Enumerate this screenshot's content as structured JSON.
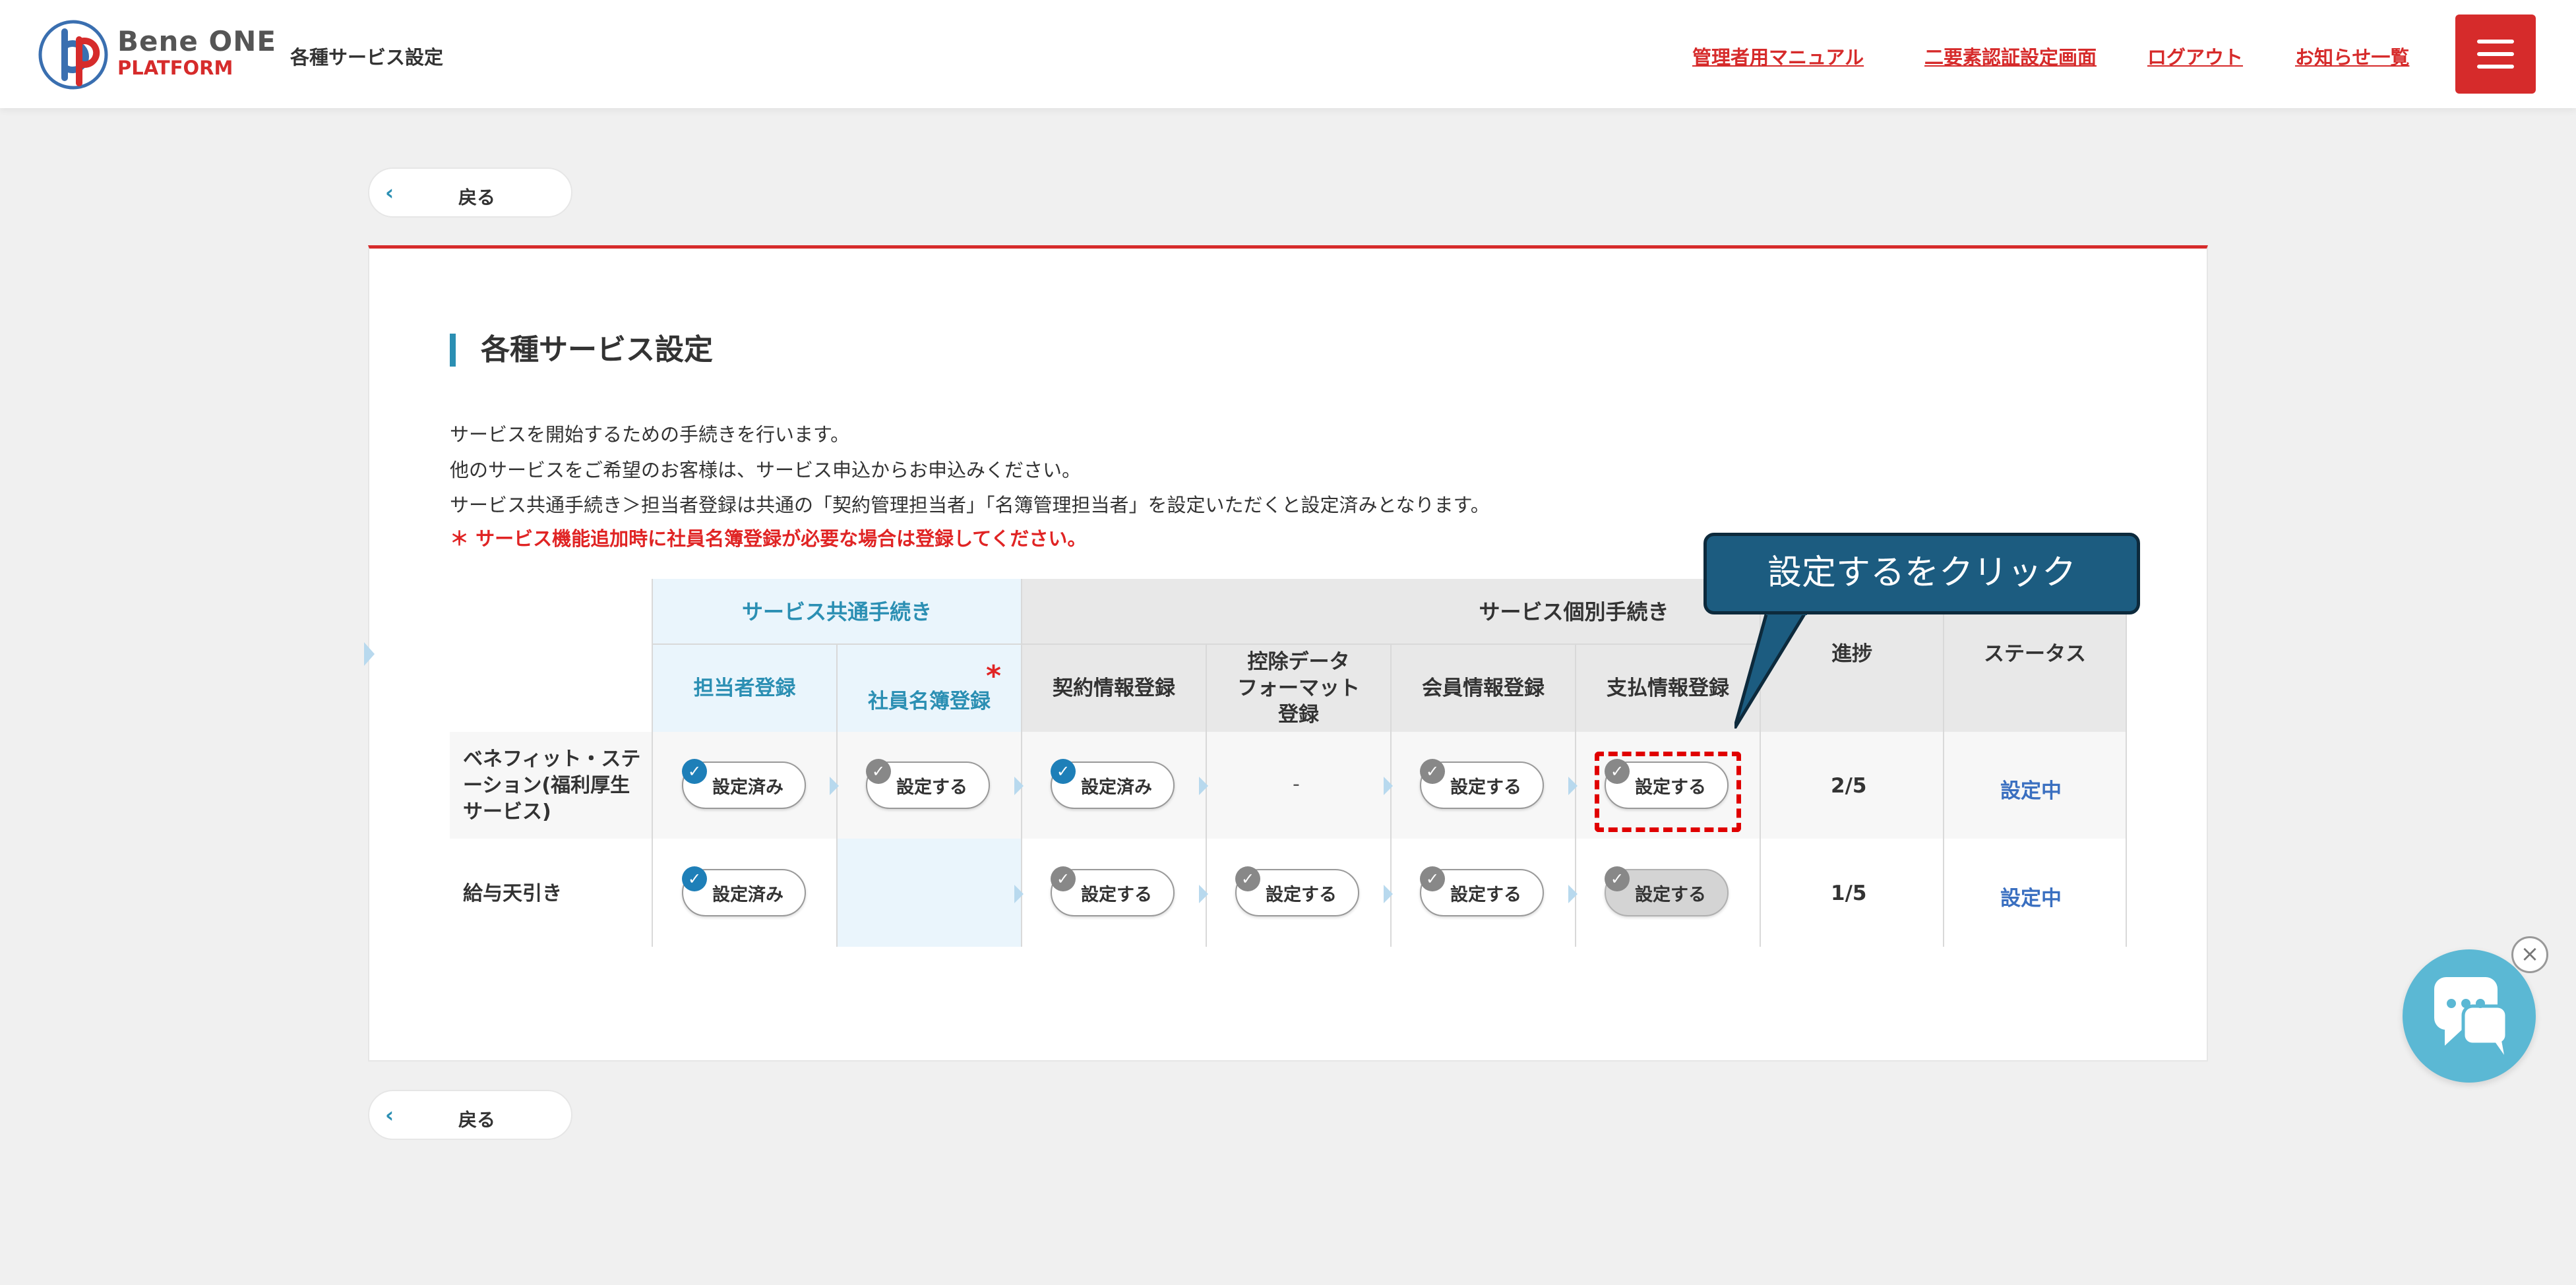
{
  "header": {
    "brand_top": "Bene ONE",
    "brand_bottom": "PLATFORM",
    "title": "各種サービス設定",
    "links": [
      "管理者用マニュアル",
      "二要素認証設定画面",
      "ログアウト",
      "お知らせ一覧"
    ],
    "menu_icon": "hamburger-icon"
  },
  "back_label": "戻る",
  "section": {
    "title": "各種サービス設定",
    "desc": [
      "サービスを開始するための手続きを行います。",
      "他のサービスをご希望のお客様は、サービス申込からお申込みください。",
      "サービス共通手続き＞担当者登録は共通の「契約管理担当者」「名簿管理担当者」を設定いただくと設定済みとなります。"
    ],
    "note": "＊ サービス機能追加時に社員名簿登録が必要な場合は登録してください。"
  },
  "table": {
    "group_common": "サービス共通手続き",
    "group_individual": "サービス個別手続き",
    "required_mark": "*",
    "columns": {
      "tanto": "担当者登録",
      "meibo": "社員名簿登録",
      "keiyaku": "契約情報登録",
      "kojo": "控除データ\nフォーマット\n登録",
      "kaiin": "会員情報登録",
      "shiharai": "支払情報登録",
      "progress": "進捗",
      "status": "ステータス"
    },
    "rows": [
      {
        "label": "ベネフィット・ステ\nーション(福利厚生\nサービス)",
        "tanto": "設定済み",
        "meibo": "設定する",
        "keiyaku": "設定済み",
        "kojo": "-",
        "kaiin": "設定する",
        "shiharai": "設定する",
        "progress": "2/5",
        "status": "設定中"
      },
      {
        "label": "給与天引き",
        "tanto": "設定済み",
        "keiyaku": "設定する",
        "kojo": "設定する",
        "kaiin": "設定する",
        "shiharai": "設定する",
        "progress": "1/5",
        "status": "設定中"
      }
    ]
  },
  "callout": "設定するをクリック",
  "chat": {
    "icon": "chat-bubble-icon",
    "close_icon": "close-icon"
  }
}
